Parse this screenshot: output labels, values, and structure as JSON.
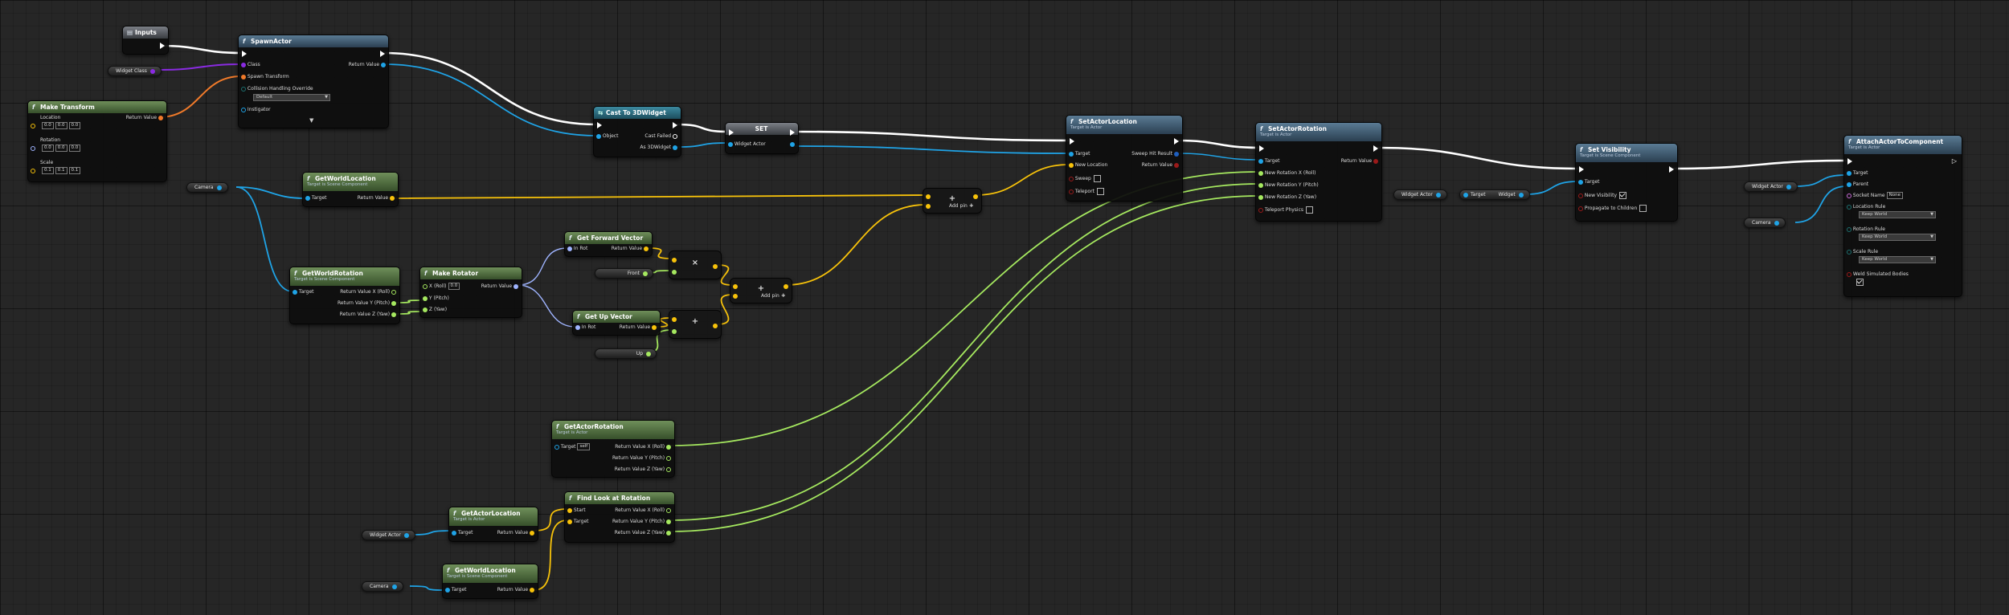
{
  "colors": {
    "exec": "#ffffff",
    "object": "#1fa3e6",
    "vector": "#f7c20a",
    "rotator": "#9fb4ff",
    "float": "#a5e85f",
    "class": "#8a2be2",
    "transform": "#f07a2a",
    "bool": "#9a1a1a"
  },
  "icons": {
    "function": "function-f-icon",
    "event": "event-icon",
    "cast": "cast-icon",
    "exec": "exec-pin-icon",
    "data": "data-pin-icon",
    "checkbox": "checkbox-icon",
    "dropdown": "chevron-down-icon"
  },
  "nodes": {
    "inputs": {
      "title": "Inputs"
    },
    "spawn": {
      "title": "SpawnActor",
      "pins": {
        "class": "Class",
        "transform": "Spawn Transform",
        "collision": "Collision Handling Override",
        "collision_value": "Default",
        "instigator": "Instigator",
        "ret": "Return Value"
      }
    },
    "make_transform": {
      "title": "Make Transform",
      "pins": {
        "location": "Location",
        "rotation": "Rotation",
        "scale": "Scale",
        "ret": "Return Value"
      },
      "loc": [
        "0.0",
        "0.0",
        "0.0"
      ],
      "rot": [
        "0.0",
        "0.0",
        "0.0"
      ],
      "scl": [
        "0.1",
        "0.1",
        "0.1"
      ]
    },
    "cast": {
      "title": "Cast To 3DWidget",
      "pins": {
        "object": "Object",
        "failed": "Cast Failed",
        "as": "As 3DWidget"
      }
    },
    "set": {
      "title": "SET",
      "pins": {
        "widget_actor": "Widget Actor"
      }
    },
    "set_loc": {
      "title": "SetActorLocation",
      "subtitle": "Target is Actor",
      "pins": {
        "target": "Target",
        "new_loc": "New Location",
        "sweep": "Sweep",
        "teleport": "Teleport",
        "hit": "Sweep Hit Result",
        "ret": "Return Value"
      }
    },
    "set_rot": {
      "title": "SetActorRotation",
      "subtitle": "Target is Actor",
      "pins": {
        "target": "Target",
        "x": "New Rotation X (Roll)",
        "y": "New Rotation Y (Pitch)",
        "z": "New Rotation Z (Yaw)",
        "teleport": "Teleport Physics",
        "ret": "Return Value"
      }
    },
    "set_vis": {
      "title": "Set Visibility",
      "subtitle": "Target is Scene Component",
      "pins": {
        "target": "Target",
        "new_vis": "New Visibility",
        "propagate": "Propagate to Children"
      }
    },
    "attach": {
      "title": "AttachActorToComponent",
      "subtitle": "Target is Actor",
      "pins": {
        "target": "Target",
        "parent": "Parent",
        "socket": "Socket Name",
        "socket_value": "None",
        "loc_rule": "Location Rule",
        "rot_rule": "Rotation Rule",
        "scale_rule": "Scale Rule",
        "rule_value": "Keep World",
        "weld": "Weld Simulated Bodies"
      }
    },
    "gwl1": {
      "title": "GetWorldLocation",
      "subtitle": "Target is Scene Component",
      "pins": {
        "target": "Target",
        "ret": "Return Value"
      }
    },
    "gwr": {
      "title": "GetWorldRotation",
      "subtitle": "Target is Scene Component",
      "pins": {
        "target": "Target",
        "x": "Return Value X (Roll)",
        "y": "Return Value Y (Pitch)",
        "z": "Return Value Z (Yaw)"
      }
    },
    "make_rot": {
      "title": "Make Rotator",
      "pins": {
        "x": "X (Roll)",
        "x_value": "0.0",
        "y": "Y (Pitch)",
        "z": "Z (Yaw)",
        "ret": "Return Value"
      }
    },
    "fwd": {
      "title": "Get Forward Vector",
      "pins": {
        "in": "In Rot",
        "ret": "Return Value"
      }
    },
    "up": {
      "title": "Get Up Vector",
      "pins": {
        "in": "In Rot",
        "ret": "Return Value"
      }
    },
    "gar": {
      "title": "GetActorRotation",
      "subtitle": "Target is Actor",
      "pins": {
        "target": "Target",
        "target_value": "self",
        "x": "Return Value X (Roll)",
        "y": "Return Value Y (Pitch)",
        "z": "Return Value Z (Yaw)"
      }
    },
    "flr": {
      "title": "Find Look at Rotation",
      "pins": {
        "start": "Start",
        "target": "Target",
        "x": "Return Value X (Roll)",
        "y": "Return Value Y (Pitch)",
        "z": "Return Value Z (Yaw)"
      }
    },
    "gal": {
      "title": "GetActorLocation",
      "subtitle": "Target is Actor",
      "pins": {
        "target": "Target",
        "ret": "Return Value"
      }
    },
    "gwl2": {
      "title": "GetWorldLocation",
      "subtitle": "Target is Scene Component",
      "pins": {
        "target": "Target",
        "ret": "Return Value"
      }
    },
    "get_widget": {
      "target": "Target",
      "widget": "Widget"
    }
  },
  "vars": {
    "widget_class": "Widget Class",
    "camera": "Camera",
    "front": "Front",
    "up": "Up",
    "widget_actor": "Widget Actor"
  },
  "ops": {
    "add_pin": "Add pin",
    "multiply": "×",
    "add": "+"
  }
}
